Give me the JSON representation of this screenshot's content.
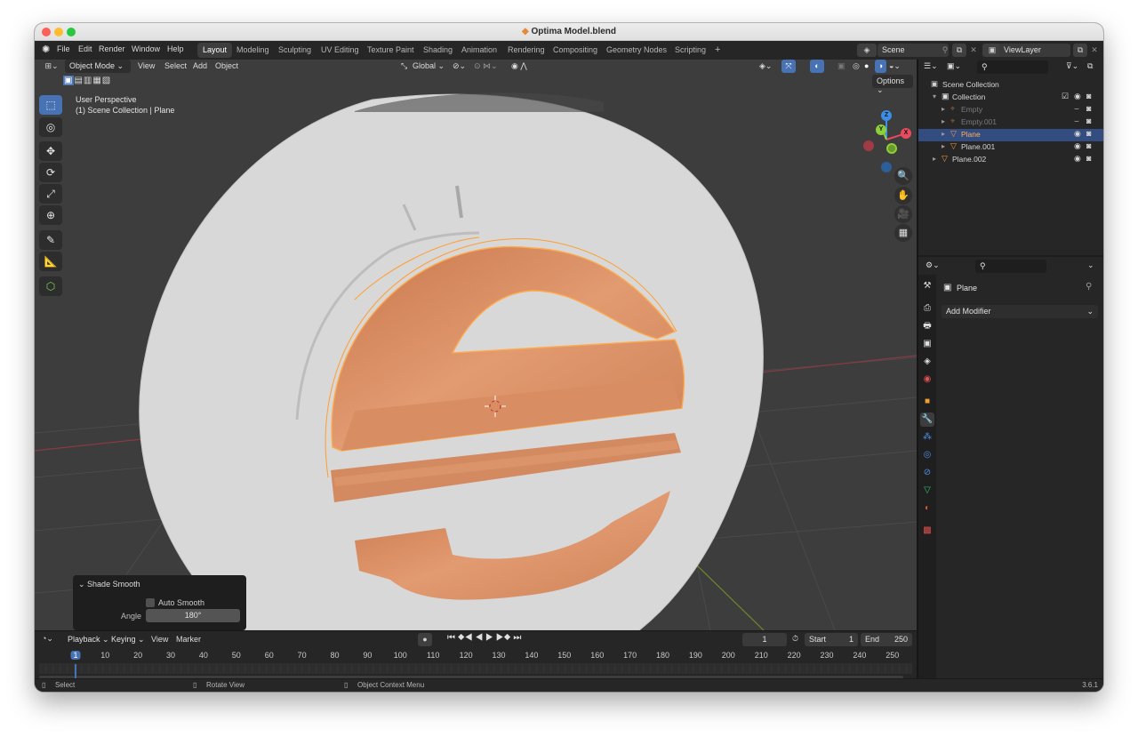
{
  "window": {
    "title": "Optima Model.blend"
  },
  "menubar": {
    "items": [
      "File",
      "Edit",
      "Render",
      "Window",
      "Help"
    ]
  },
  "workspaces": {
    "active": "Layout",
    "tabs": [
      "Layout",
      "Modeling",
      "Sculpting",
      "UV Editing",
      "Texture Paint",
      "Shading",
      "Animation",
      "Rendering",
      "Compositing",
      "Geometry Nodes",
      "Scripting"
    ],
    "add": "+"
  },
  "scene": {
    "name": "Scene"
  },
  "view_layer": {
    "name": "ViewLayer"
  },
  "viewport": {
    "mode": "Object Mode",
    "menus": [
      "View",
      "Select",
      "Add",
      "Object"
    ],
    "transform_orientation": "Global",
    "options_label": "Options",
    "overlay_line1": "User Perspective",
    "overlay_line2": "(1) Scene Collection | Plane",
    "gizmo": {
      "z": "Z",
      "y": "Y",
      "x": "X"
    }
  },
  "redo_panel": {
    "title": "Shade Smooth",
    "auto_smooth_label": "Auto Smooth",
    "auto_smooth_checked": false,
    "angle_label": "Angle",
    "angle_value": "180°"
  },
  "timeline": {
    "menus": [
      "Playback",
      "Keying",
      "View",
      "Marker"
    ],
    "current_frame": "1",
    "start_label": "Start",
    "start_value": "1",
    "end_label": "End",
    "end_value": "250",
    "ticks": [
      "1",
      "10",
      "20",
      "30",
      "40",
      "50",
      "60",
      "70",
      "80",
      "90",
      "100",
      "110",
      "120",
      "130",
      "140",
      "150",
      "160",
      "170",
      "180",
      "190",
      "200",
      "210",
      "220",
      "230",
      "240",
      "250"
    ]
  },
  "outliner": {
    "root": "Scene Collection",
    "items": [
      {
        "label": "Collection",
        "indent": 1,
        "selected": false,
        "dim": false
      },
      {
        "label": "Empty",
        "indent": 2,
        "selected": false,
        "dim": true
      },
      {
        "label": "Empty.001",
        "indent": 2,
        "selected": false,
        "dim": true
      },
      {
        "label": "Plane",
        "indent": 2,
        "selected": true,
        "dim": false
      },
      {
        "label": "Plane.001",
        "indent": 2,
        "selected": false,
        "dim": false
      },
      {
        "label": "Plane.002",
        "indent": 1,
        "selected": false,
        "dim": false
      }
    ]
  },
  "properties": {
    "object_name": "Plane",
    "add_modifier_label": "Add Modifier"
  },
  "statusbar": {
    "select": "Select",
    "rotate": "Rotate View",
    "context": "Object Context Menu",
    "version": "3.6.1"
  },
  "colors": {
    "accent": "#4772b3",
    "object_orange": "#d98a5e",
    "selection_outline": "#ff9d2e",
    "x_axis": "#e84a5f",
    "y_axis": "#8ccf3a",
    "z_axis": "#3b8ee8"
  }
}
